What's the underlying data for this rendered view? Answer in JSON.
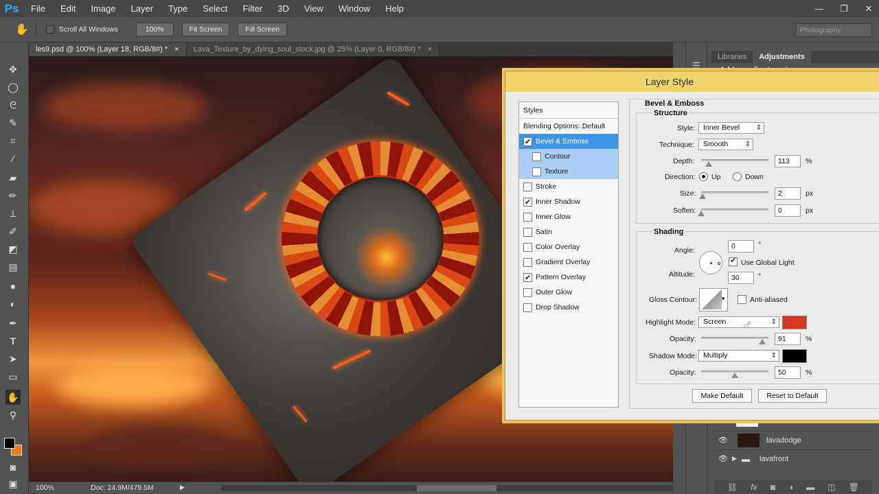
{
  "app": {
    "logo": "Ps",
    "menus": [
      "File",
      "Edit",
      "Image",
      "Layer",
      "Type",
      "Select",
      "Filter",
      "3D",
      "View",
      "Window",
      "Help"
    ],
    "window_controls": [
      "—",
      "❐",
      "✕"
    ]
  },
  "options_bar": {
    "scroll_all_label": "Scroll All Windows",
    "zoom_button": "100%",
    "fit_screen": "Fit Screen",
    "fill_screen": "Fill Screen",
    "workspace": "Photography"
  },
  "tabs": [
    {
      "label": "les9.psd @ 100% (Layer 18, RGB/8#) *",
      "close": "×"
    },
    {
      "label": "Lava_Texture_by_dying_soul_stock.jpg @ 25% (Layer 0, RGB/8#) *",
      "close": "×"
    }
  ],
  "status_bar": {
    "zoom": "100%",
    "doc": "Doc: 24.9M/479.5M"
  },
  "panels": {
    "tabs": [
      "Libraries",
      "Adjustments"
    ],
    "adjustments_hint": "Add an adjustment",
    "layers": [
      {
        "name": "lavadodge"
      },
      {
        "name": "lavafront"
      }
    ]
  },
  "dialog": {
    "title": "Layer Style",
    "styles_header": "Styles",
    "blending_options": "Blending Options: Default",
    "styles": [
      {
        "label": "Bevel & Emboss",
        "checked": true
      },
      {
        "label": "Contour",
        "checked": false
      },
      {
        "label": "Texture",
        "checked": false
      },
      {
        "label": "Stroke",
        "checked": false
      },
      {
        "label": "Inner Shadow",
        "checked": true
      },
      {
        "label": "Inner Glow",
        "checked": false
      },
      {
        "label": "Satin",
        "checked": false
      },
      {
        "label": "Color Overlay",
        "checked": false
      },
      {
        "label": "Gradient Overlay",
        "checked": false
      },
      {
        "label": "Pattern Overlay",
        "checked": true
      },
      {
        "label": "Outer Glow",
        "checked": false
      },
      {
        "label": "Drop Shadow",
        "checked": false
      }
    ],
    "section_title": "Bevel & Emboss",
    "structure": {
      "title": "Structure",
      "style_label": "Style:",
      "style_value": "Inner Bevel",
      "technique_label": "Technique:",
      "technique_value": "Smooth",
      "depth_label": "Depth:",
      "depth_value": "113",
      "depth_unit": "%",
      "depth_level": 0.113,
      "direction_label": "Direction:",
      "direction_up": "Up",
      "direction_down": "Down",
      "size_label": "Size:",
      "size_value": "2",
      "size_unit": "px",
      "soften_label": "Soften:",
      "soften_value": "0",
      "soften_unit": "px"
    },
    "shading": {
      "title": "Shading",
      "angle_label": "Angle:",
      "angle_value": "0",
      "degree": "°",
      "use_global_light": "Use Global Light",
      "altitude_label": "Altitude:",
      "altitude_value": "30",
      "gloss_contour_label": "Gloss Contour:",
      "anti_aliased": "Anti-aliased",
      "highlight_mode_label": "Highlight Mode:",
      "highlight_mode_value": "Screen",
      "highlight_color": "#d23a22",
      "highlight_opacity_label": "Opacity:",
      "highlight_opacity_value": "91",
      "highlight_opacity_unit": "%",
      "shadow_mode_label": "Shadow Mode:",
      "shadow_mode_value": "Multiply",
      "shadow_color": "#000000",
      "shadow_opacity_label": "Opacity:",
      "shadow_opacity_value": "50",
      "shadow_opacity_unit": "%"
    },
    "make_default": "Make Default",
    "reset_default": "Reset to Default"
  }
}
